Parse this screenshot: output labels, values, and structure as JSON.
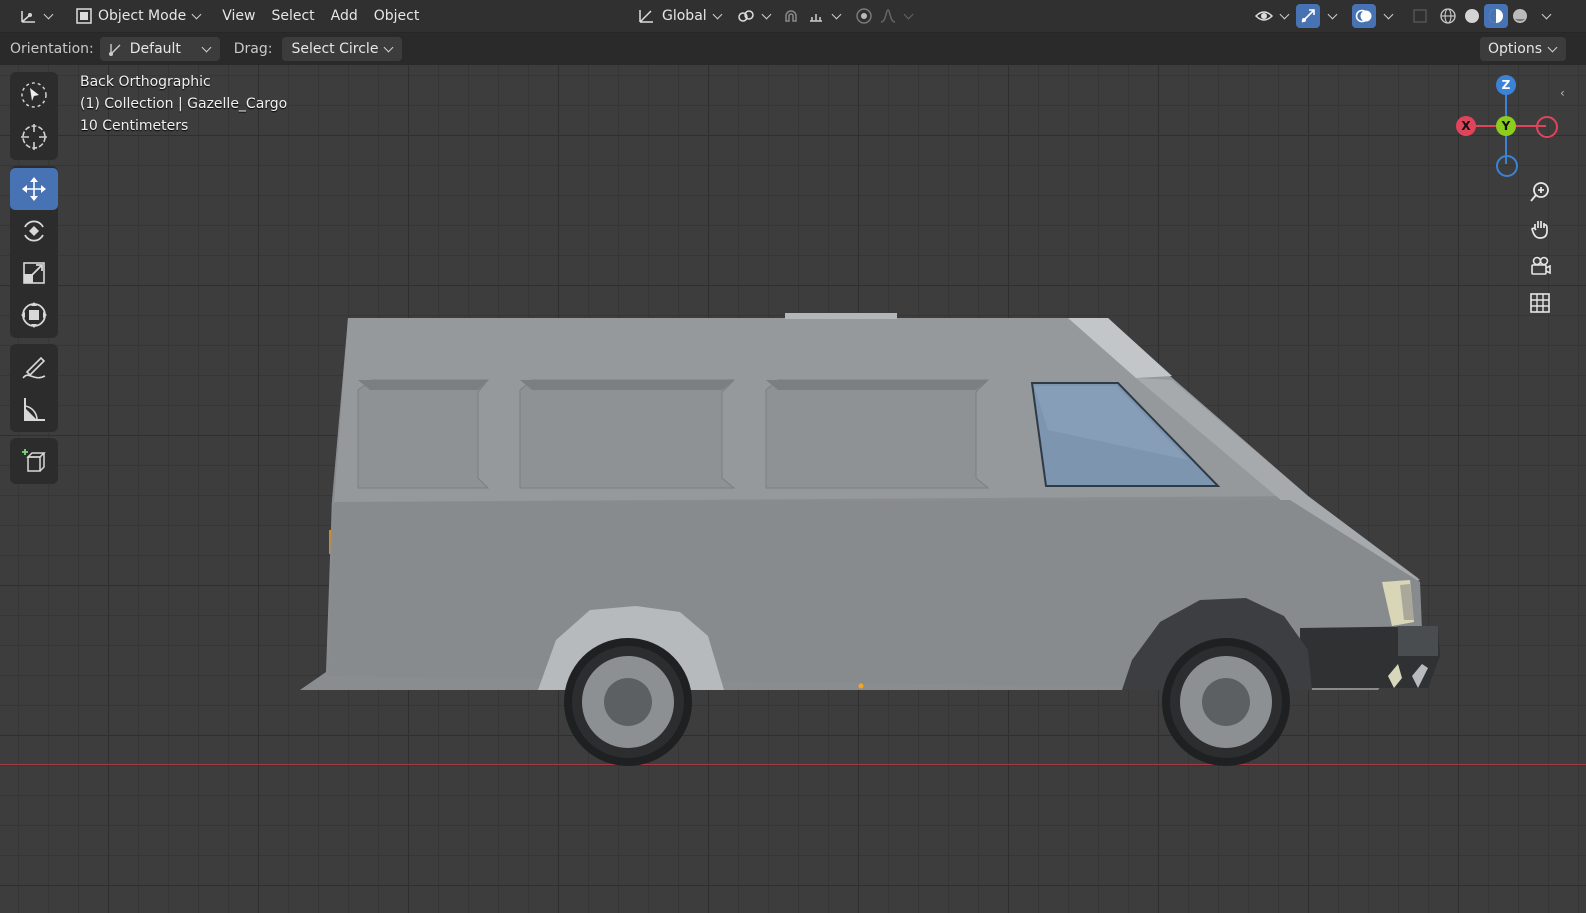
{
  "header": {
    "mode_label": "Object Mode",
    "menus": [
      "View",
      "Select",
      "Add",
      "Object"
    ],
    "transform_orientation": "Global"
  },
  "tool_settings": {
    "orientation_label": "Orientation:",
    "orientation_value": "Default",
    "drag_label": "Drag:",
    "drag_value": "Select Circle",
    "options_label": "Options"
  },
  "viewport_info": {
    "view_name": "Back Orthographic",
    "collection_line": "(1) Collection | Gazelle_Cargo",
    "grid_scale": "10 Centimeters"
  },
  "toolbar": {
    "tools": [
      "select-box",
      "cursor",
      "move",
      "rotate",
      "scale",
      "transform",
      "annotate",
      "measure",
      "add-cube"
    ],
    "active_tool": "move"
  },
  "gizmo": {
    "labels": {
      "z": "Z",
      "x": "X",
      "y": "Y"
    },
    "colors": {
      "x": "#e0445a",
      "y": "#8bcc1f",
      "z": "#3b83d6"
    }
  },
  "colors": {
    "accent": "#4772b3",
    "van_body": "#8c8f92",
    "window": "#7d95af",
    "x_axis_line": "#a63a45"
  }
}
